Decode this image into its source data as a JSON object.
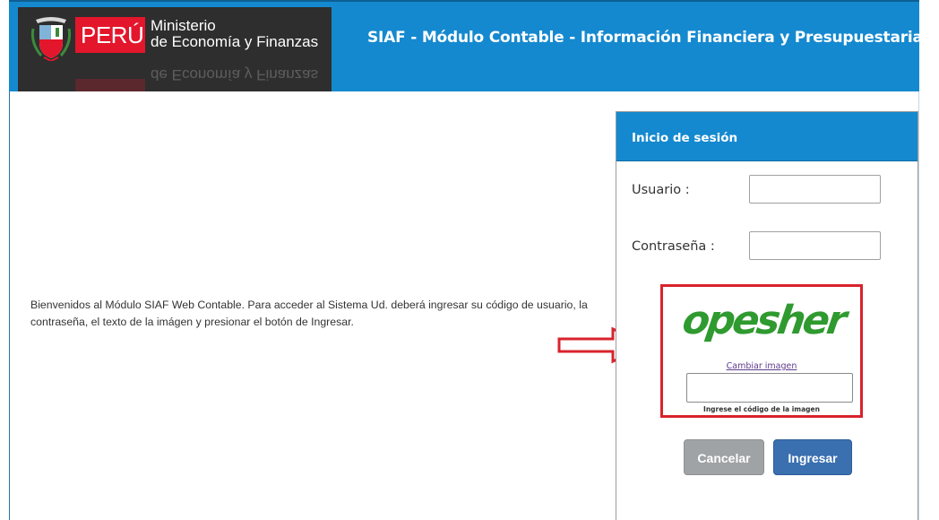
{
  "header": {
    "country": "PERÚ",
    "ministry_line1": "Ministerio",
    "ministry_line2": "de Economía y Finanzas",
    "title": "SIAF - Módulo Contable - Información Financiera y Presupuestaria",
    "brand_color": "#1589cf",
    "peru_red": "#e3162c"
  },
  "welcome": {
    "text": "Bienvenidos al Módulo SIAF Web Contable. Para acceder al Sistema Ud. deberá ingresar su código de usuario, la contraseña, el texto de la imágen y presionar el botón de Ingresar."
  },
  "login": {
    "title": "Inicio de sesión",
    "user_label": "Usuario :",
    "user_value": "",
    "password_label": "Contraseña :",
    "password_value": "",
    "captcha_text": "opesher",
    "captcha_change_link": "Cambiar imagen",
    "captcha_value": "",
    "captcha_hint": "Ingrese el código de la imagen",
    "cancel_label": "Cancelar",
    "submit_label": "Ingresar",
    "highlight_color": "#d9232d"
  }
}
